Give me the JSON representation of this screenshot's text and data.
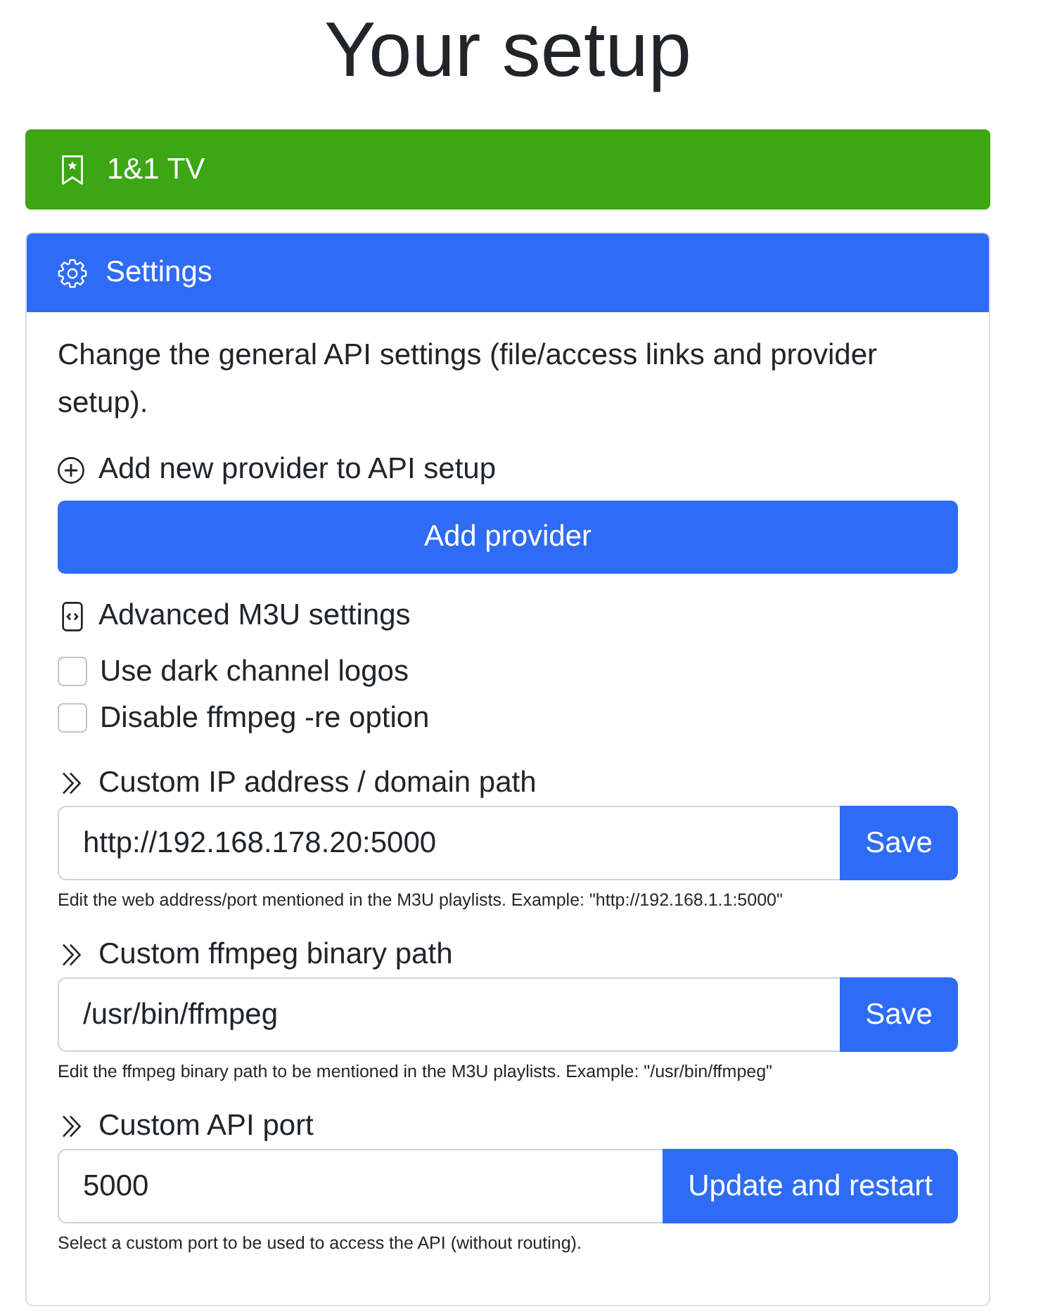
{
  "page": {
    "title": "Your setup"
  },
  "provider": {
    "name": "1&1 TV"
  },
  "settings": {
    "title": "Settings",
    "description": "Change the general API settings (file/access links and provider setup).",
    "sections": [
      {
        "kind": "action",
        "heading": "Add new provider to API setup",
        "button": "Add provider"
      },
      {
        "kind": "options",
        "heading": "Advanced M3U settings",
        "options": [
          {
            "label": "Use dark channel logos",
            "checked": false
          },
          {
            "label": "Disable ffmpeg -re option",
            "checked": false
          }
        ]
      },
      {
        "kind": "field",
        "heading": "Custom IP address / domain path",
        "value": "http://192.168.178.20:5000",
        "button": "Save",
        "help": "Edit the web address/port mentioned in the M3U playlists. Example: \"http://192.168.1.1:5000\""
      },
      {
        "kind": "field",
        "heading": "Custom ffmpeg binary path",
        "value": "/usr/bin/ffmpeg",
        "button": "Save",
        "help": "Edit the ffmpeg binary path to be mentioned in the M3U playlists. Example: \"/usr/bin/ffmpeg\""
      },
      {
        "kind": "field",
        "heading": "Custom API port",
        "value": "5000",
        "button": "Update and restart",
        "help": "Select a custom port to be used to access the API (without routing)."
      }
    ]
  }
}
